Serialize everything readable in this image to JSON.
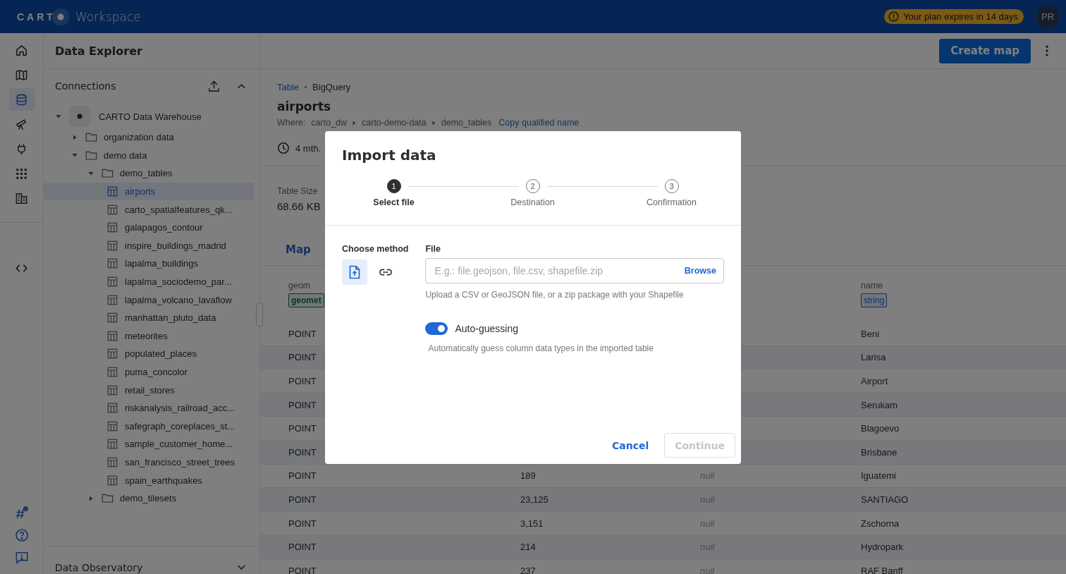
{
  "topbar": {
    "logo": "CART",
    "product": "Workspace",
    "plan_notice": "Your plan expires in 14 days",
    "avatar": "PR"
  },
  "rail": [
    {
      "selected": false
    },
    {
      "selected": false
    },
    {
      "selected": true
    },
    {
      "selected": false
    },
    {
      "selected": false
    },
    {
      "selected": false
    },
    {
      "selected": false
    }
  ],
  "explorer": {
    "title": "Data Explorer",
    "connections_label": "Connections",
    "tree": [
      {
        "kind": "connection",
        "label": "CARTO Data Warehouse",
        "expanded": true,
        "selected": false,
        "children": [
          {
            "kind": "folder",
            "label": "organization data",
            "expanded": false,
            "selected": false
          },
          {
            "kind": "folder",
            "label": "demo data",
            "expanded": true,
            "selected": false,
            "children": [
              {
                "kind": "folder",
                "label": "demo_tables",
                "expanded": true,
                "selected": false,
                "children": [
                  {
                    "kind": "table",
                    "label": "airports",
                    "selected": true
                  },
                  {
                    "kind": "table",
                    "label": "carto_spatialfeatures_qk...",
                    "selected": false
                  },
                  {
                    "kind": "table",
                    "label": "galapagos_contour",
                    "selected": false
                  },
                  {
                    "kind": "table",
                    "label": "inspire_buildings_madrid",
                    "selected": false
                  },
                  {
                    "kind": "table",
                    "label": "lapalma_buildings",
                    "selected": false
                  },
                  {
                    "kind": "table",
                    "label": "lapalma_sociodemo_par...",
                    "selected": false
                  },
                  {
                    "kind": "table",
                    "label": "lapalma_volcano_lavaflow",
                    "selected": false
                  },
                  {
                    "kind": "table",
                    "label": "manhattan_pluto_data",
                    "selected": false
                  },
                  {
                    "kind": "table",
                    "label": "meteorites",
                    "selected": false
                  },
                  {
                    "kind": "table",
                    "label": "populated_places",
                    "selected": false
                  },
                  {
                    "kind": "table",
                    "label": "puma_concolor",
                    "selected": false
                  },
                  {
                    "kind": "table",
                    "label": "retail_stores",
                    "selected": false
                  },
                  {
                    "kind": "table",
                    "label": "riskanalysis_railroad_acc...",
                    "selected": false
                  },
                  {
                    "kind": "table",
                    "label": "safegraph_coreplaces_st...",
                    "selected": false
                  },
                  {
                    "kind": "table",
                    "label": "sample_customer_home...",
                    "selected": false
                  },
                  {
                    "kind": "table",
                    "label": "san_francisco_street_trees",
                    "selected": false
                  },
                  {
                    "kind": "table",
                    "label": "spain_earthquakes",
                    "selected": false
                  }
                ]
              },
              {
                "kind": "folder",
                "label": "demo_tilesets",
                "expanded": false,
                "selected": false
              }
            ]
          }
        ]
      }
    ],
    "footer": "Data Observatory"
  },
  "main": {
    "create_map": "Create map",
    "breadcrumb": {
      "type": "Table",
      "source": "BigQuery"
    },
    "title": "airports",
    "where": {
      "label": "Where:",
      "path": [
        "carto_dw",
        "carto-demo-data",
        "demo_tables"
      ],
      "copy_link": "Copy qualified name"
    },
    "updated": "4 mth.",
    "size": {
      "label": "Table Size",
      "value": "68.66 KB"
    },
    "tabs": [
      {
        "label": "Map",
        "selected": true
      }
    ],
    "table": {
      "columns": [
        {
          "name": "geom",
          "type": "geomet",
          "kind": "geometry"
        },
        {
          "name": "name",
          "type": "string",
          "kind": "string"
        }
      ],
      "rows": [
        {
          "geom": "POINT",
          "name": "Beni"
        },
        {
          "geom": "POINT",
          "name": "Larisa"
        },
        {
          "geom": "POINT",
          "name": "Airport"
        },
        {
          "geom": "POINT",
          "name": "Serukam"
        },
        {
          "geom": "POINT",
          "name": "Blagoevo"
        },
        {
          "geom": "POINT",
          "name": "Brisbane"
        },
        {
          "geom": "POINT",
          "column_2": "189",
          "column_3": "null",
          "name": "Iguatemi"
        },
        {
          "geom": "POINT",
          "column_2": "23,125",
          "column_3": "null",
          "name": "SANTIAGO"
        },
        {
          "geom": "POINT",
          "column_2": "3,151",
          "column_3": "null",
          "name": "Zschorna"
        },
        {
          "geom": "POINT",
          "column_2": "214",
          "column_3": "null",
          "name": "Hydropark"
        },
        {
          "geom": "POINT",
          "column_2": "237",
          "column_3": "null",
          "name": "RAF Banff"
        }
      ]
    }
  },
  "modal": {
    "title": "Import data",
    "steps": [
      {
        "number": "1",
        "label": "Select file",
        "selected": true
      },
      {
        "number": "2",
        "label": "Destination",
        "selected": false
      },
      {
        "number": "3",
        "label": "Confirmation",
        "selected": false
      }
    ],
    "method_label": "Choose method",
    "methods": [
      {
        "kind": "upload",
        "selected": true
      },
      {
        "kind": "link",
        "selected": false
      }
    ],
    "file_label": "File",
    "file_placeholder": "E.g.: file.geojson, file.csv, shapefile.zip",
    "browse": "Browse",
    "file_help": "Upload a CSV or GeoJSON file, or a zip package with your Shapefile",
    "auto_guessing": {
      "label": "Auto-guessing",
      "on": true,
      "help": "Automatically guess column data types in the imported table"
    },
    "cancel": "Cancel",
    "continue": {
      "label": "Continue",
      "disabled": true
    }
  }
}
